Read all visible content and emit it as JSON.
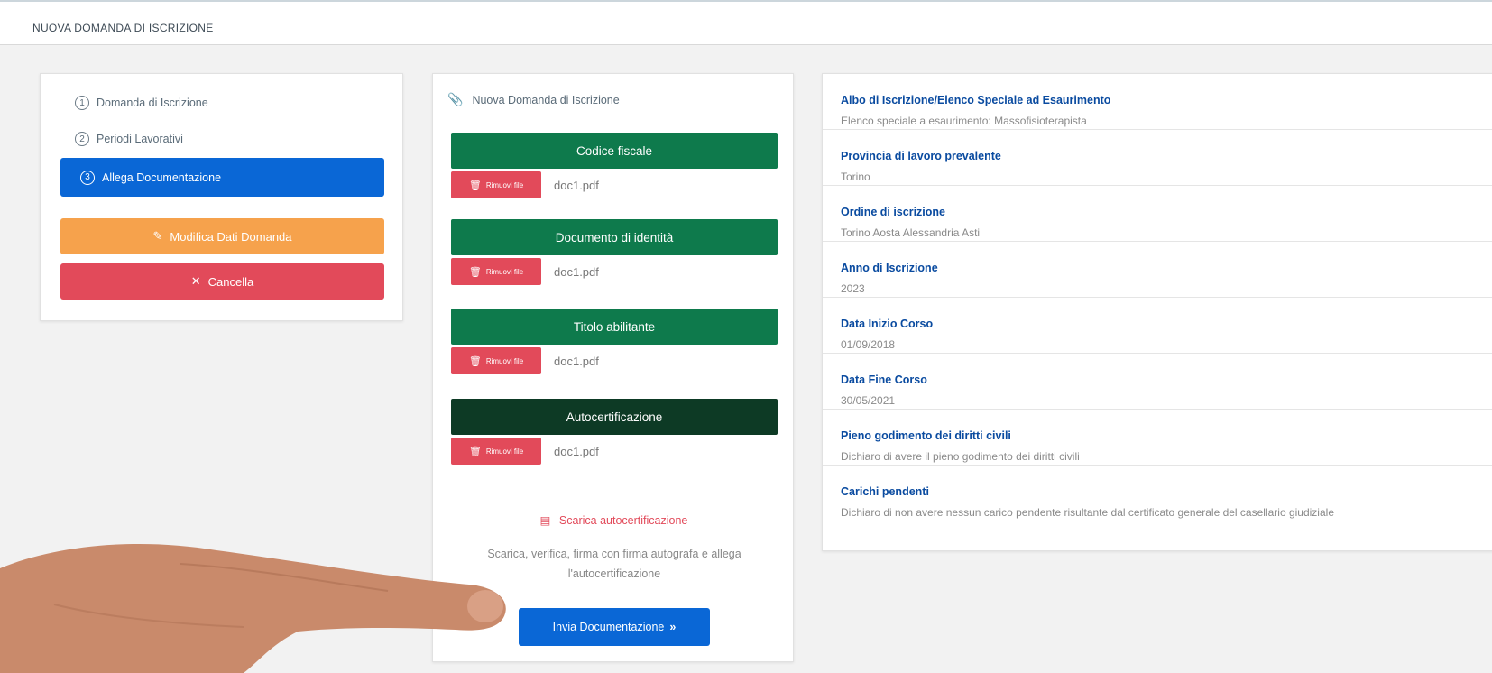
{
  "header": {
    "title": "NUOVA DOMANDA DI ISCRIZIONE"
  },
  "steps": [
    {
      "num": "1",
      "label": "Domanda di Iscrizione"
    },
    {
      "num": "2",
      "label": "Periodi Lavorativi"
    },
    {
      "num": "3",
      "label": "Allega Documentazione"
    }
  ],
  "actions": {
    "edit_label": "Modifica Dati Domanda",
    "cancel_label": "Cancella"
  },
  "upload": {
    "header": "Nuova Domanda di Iscrizione",
    "documents": [
      {
        "title": "Codice fiscale",
        "remove_label": "Rimuovi file",
        "file": "doc1.pdf"
      },
      {
        "title": "Documento di identità",
        "remove_label": "Rimuovi file",
        "file": "doc1.pdf"
      },
      {
        "title": "Titolo abilitante",
        "remove_label": "Rimuovi file",
        "file": "doc1.pdf"
      },
      {
        "title": "Autocertificazione",
        "remove_label": "Rimuovi file",
        "file": "doc1.pdf"
      }
    ],
    "download_label": "Scarica autocertificazione",
    "instructions": "Scarica, verifica, firma con firma autografa e allega l'autocertificazione",
    "send_label": "Invia Documentazione"
  },
  "details": [
    {
      "label": "Albo di Iscrizione/Elenco Speciale ad Esaurimento",
      "value": "Elenco speciale a esaurimento: Massofisioterapista"
    },
    {
      "label": "Provincia di lavoro prevalente",
      "value": "Torino"
    },
    {
      "label": "Ordine di iscrizione",
      "value": "Torino Aosta Alessandria Asti"
    },
    {
      "label": "Anno di Iscrizione",
      "value": "2023"
    },
    {
      "label": "Data Inizio Corso",
      "value": "01/09/2018"
    },
    {
      "label": "Data Fine Corso",
      "value": "30/05/2021"
    },
    {
      "label": "Pieno godimento dei diritti civili",
      "value": "Dichiaro di avere il pieno godimento dei diritti civili"
    },
    {
      "label": "Carichi pendenti",
      "value": "Dichiaro di non avere nessun carico pendente risultante dal certificato generale del casellario giudiziale"
    }
  ],
  "colors": {
    "primary_blue": "#0a67d6",
    "green": "#0e7a4c",
    "dark_green": "#0d3a25",
    "danger_red": "#e24a5a",
    "warning_orange": "#f6a24c",
    "label_blue": "#0a4ba0"
  }
}
